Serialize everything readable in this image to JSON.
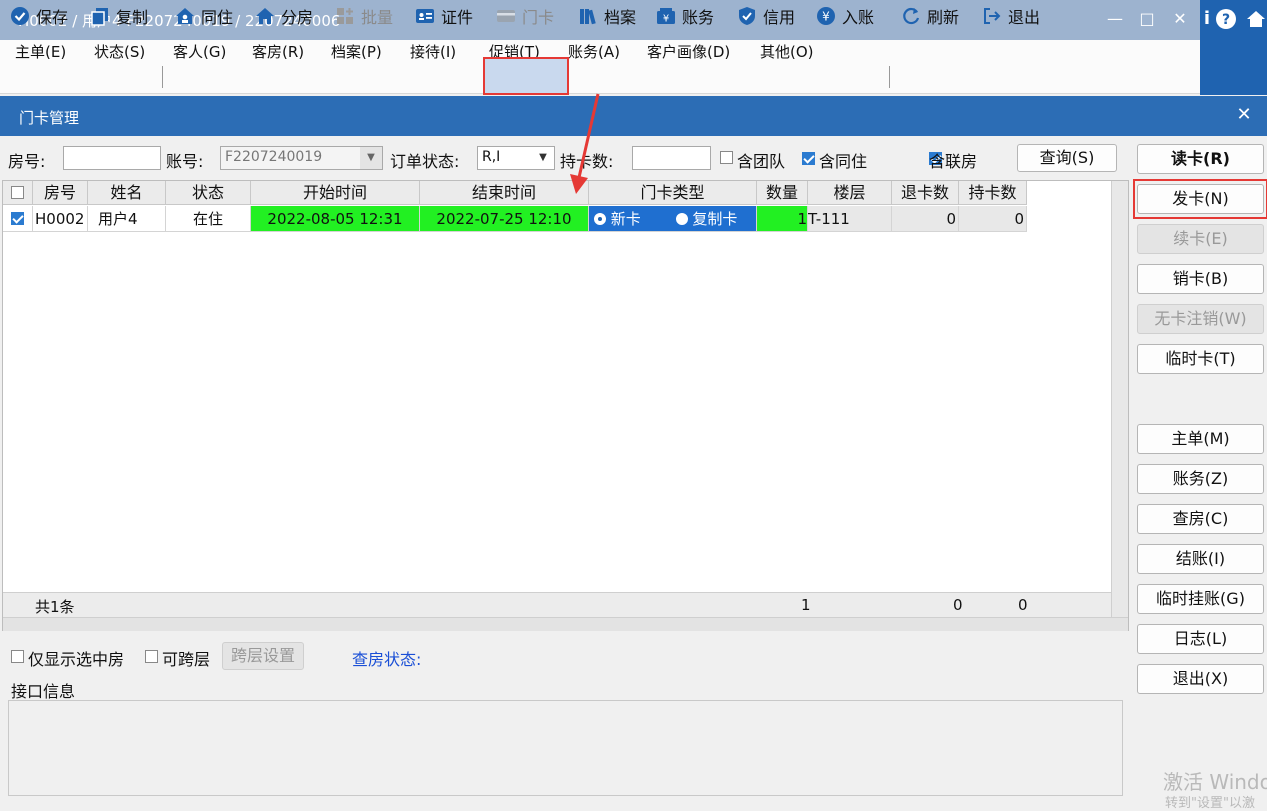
{
  "window": {
    "title": "H0002 / 用户4 F2207240019 / 2207240006"
  },
  "menu": [
    "主单(E)",
    "状态(S)",
    "客人(G)",
    "客房(R)",
    "档案(P)",
    "接待(I)",
    "促销(T)",
    "账务(A)",
    "客户画像(D)",
    "其他(O)"
  ],
  "toolbar": {
    "save": "保存",
    "copy": "复制",
    "cohabit": "同住",
    "assign_room": "分房",
    "batch": "批量",
    "id_card": "证件",
    "door_card": "门卡",
    "archive": "档案",
    "account": "账务",
    "credit": "信用",
    "post": "入账",
    "refresh": "刷新",
    "exit": "退出"
  },
  "dialog": {
    "title": "门卡管理"
  },
  "filter": {
    "room_label": "房号:",
    "room_value": "",
    "account_label": "账号:",
    "account_value": "F2207240019",
    "order_status_label": "订单状态:",
    "order_status_value": "R,I",
    "card_count_label": "持卡数:",
    "card_count_value": "",
    "group_label": "含团队",
    "cohabit_label": "含同住",
    "linked_label": "含联房",
    "query_label": "查询(S)"
  },
  "grid": {
    "headers": [
      "房号",
      "姓名",
      "状态",
      "开始时间",
      "结束时间",
      "门卡类型",
      "数量",
      "楼层",
      "退卡数",
      "持卡数"
    ],
    "rows": [
      {
        "room": "H0002",
        "name": "用户4",
        "status": "在住",
        "start": "2022-08-05 12:31",
        "end": "2022-07-25 12:10",
        "type_new": "新卡",
        "type_copy": "复制卡",
        "qty": "1",
        "floor": "T-111",
        "returned": "0",
        "held": "0"
      }
    ],
    "footer": {
      "total": "共1条",
      "qty": "1",
      "returned": "0",
      "held": "0"
    }
  },
  "side_buttons": {
    "read": "读卡(R)",
    "issue": "发卡(N)",
    "renew": "续卡(E)",
    "cancel": "销卡(B)",
    "nocard": "无卡注销(W)",
    "temp": "临时卡(T)",
    "master": "主单(M)",
    "account": "账务(Z)",
    "checkroom": "查房(C)",
    "checkout": "结账(I)",
    "temphang": "临时挂账(G)",
    "log": "日志(L)",
    "exit": "退出(X)"
  },
  "bottom": {
    "only_selected": "仅显示选中房",
    "cross_floor": "可跨层",
    "cross_floor_btn": "跨层设置",
    "check_status": "查房状态:",
    "interface_info": "接口信息"
  },
  "watermark": {
    "line1": "激活 Windo",
    "line2": "转到\"设置\"以激"
  },
  "colors": {
    "title_bar": "#9db3cf",
    "dialog_header": "#2c6db5",
    "highlight_green": "#22f022",
    "highlight_red": "#e53935",
    "check_status_text": "#1a4fd6"
  }
}
